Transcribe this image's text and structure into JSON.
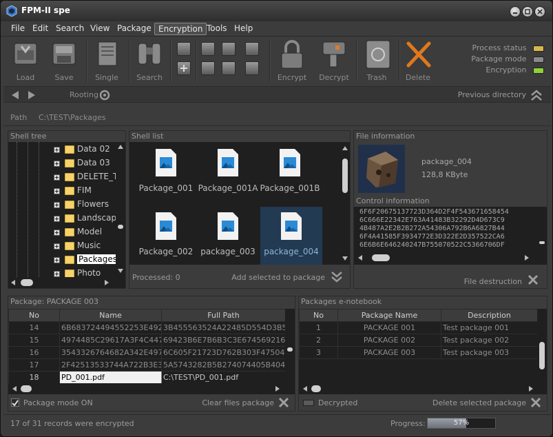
{
  "window": {
    "title": "FPM-II spe"
  },
  "menu": [
    "File",
    "Edit",
    "Search",
    "View",
    "Package",
    "Encryption",
    "Tools",
    "Help"
  ],
  "toolbar": {
    "load": "Load",
    "save": "Save",
    "single": "Single",
    "search": "Search",
    "encrypt": "Encrypt",
    "decrypt": "Decrypt",
    "trash": "Trash",
    "delete": "Delete"
  },
  "status_panel": {
    "process_status": "Process status",
    "package_mode": "Package mode",
    "encryption": "Encryption",
    "colors": {
      "process": "#d8b64a",
      "package": "#8a8a8a",
      "encryption": "#8fd13a"
    }
  },
  "nav": {
    "rooting": "Rooting",
    "previous_directory": "Previous directory"
  },
  "path": {
    "label": "Path",
    "value": "C:\\TEST\\Packages"
  },
  "shell_tree": {
    "title": "Shell tree",
    "items": [
      "Data 02",
      "Data 03",
      "DELETE_T",
      "FIM",
      "Flowers",
      "Landscap",
      "Model",
      "Music",
      "Packages",
      "Photo"
    ],
    "selected": "Packages"
  },
  "shell_list": {
    "title": "Shell list",
    "files": [
      "Package_001",
      "Package_001A",
      "Package_001B",
      "Package_002",
      "package_003",
      "package_004"
    ],
    "selected": "package_004",
    "processed": "Processed: 0",
    "add_selected": "Add selected to package"
  },
  "file_info": {
    "title": "File information",
    "name": "package_004",
    "size": "128,8 KByte"
  },
  "control_info": {
    "title": "Control information",
    "lines": [
      "6F6F20675137723D364D2F4F543671658454",
      "6C666E22342E763A41483B32292D4D673C9",
      "4B487A2E2B2B272A54306A792B6A6827B44",
      "6F4A41585F3934772E3D322E2D357522CA6",
      "6E6B6E646240247B755070522C5366706DF"
    ],
    "file_destruction": "File destruction"
  },
  "package_table": {
    "title": "Package: PACKAGE 003",
    "headers": [
      "No",
      "Name",
      "Full Path"
    ],
    "rows": [
      [
        "14",
        "6B683724494552253E49282F",
        "3B455563524A22485D554D3B506A6"
      ],
      [
        "15",
        "4974485C29617A3F4C447B4F",
        "69423B6E7B6B3C3E6745692167405"
      ],
      [
        "16",
        "3543326764682A342E497960",
        "6C605F21723D762B303F47504D3A4"
      ],
      [
        "17",
        "2F42513533744A722B3E394D",
        "5A5743282B5B274074405B404B525"
      ],
      [
        "18",
        "PD_001.pdf",
        "C:\\TEST\\PD_001.pdf"
      ]
    ],
    "package_mode": "Package mode ON",
    "clear_files": "Clear files package"
  },
  "notebook": {
    "title": "Packages e-notebook",
    "headers": [
      "No",
      "Package Name",
      "Description"
    ],
    "rows": [
      [
        "1",
        "PACKAGE 001",
        "Test package 001"
      ],
      [
        "2",
        "PACKAGE 002",
        "Test package 002"
      ],
      [
        "3",
        "PACKAGE 003",
        "Test package 003"
      ]
    ],
    "decrypted": "Decrypted",
    "delete_selected": "Delete selected  package"
  },
  "statusbar": {
    "message": "17 of 31 records were encrypted",
    "progress_label": "Progress:",
    "progress_text": "57%",
    "progress_value": 0.57
  }
}
